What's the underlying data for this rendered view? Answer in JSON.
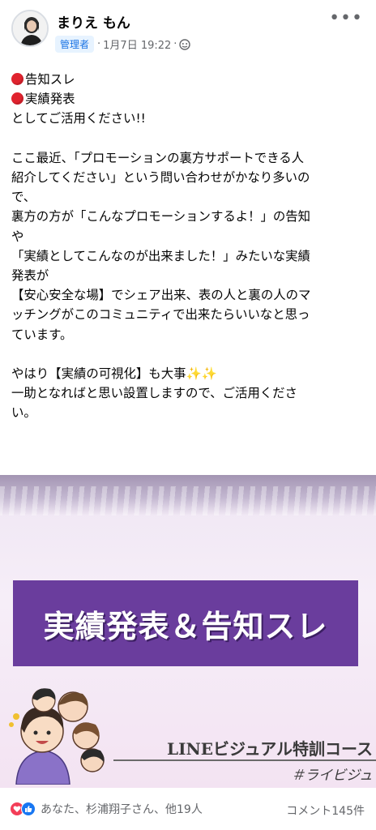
{
  "post": {
    "author": "まりえ もん",
    "badge": "管理者",
    "date": "1月7日 19:22",
    "dot": "·",
    "more": "•••",
    "lines": {
      "l1": "告知スレ",
      "l2": "実績発表",
      "l3": "としてご活用ください!!",
      "body": "ここ最近、「プロモーションの裏方サポートできる人\n紹介してください」という問い合わせがかなり多いの\nで、\n裏方の方が「こんなプロモーションするよ！」の告知\nや\n「実績としてこんなのが出来ました！」みたいな実績\n発表が\n【安心安全な場】でシェア出来、表の人と裏の人のマ\nッチングがこのコミュニティで出来たらいいなと思っ\nています。",
      "tail1": "やはり【実績の可視化】も大事✨✨",
      "tail2": "一助となればと思い設置しますので、ご活用くださ\nい。"
    }
  },
  "banner": {
    "title": "実績発表＆告知スレ",
    "course": "LINEビジュアル特訓コース",
    "tag": "＃ライビジュ"
  },
  "footer": {
    "reactions_text": "あなた、杉浦翔子さん、他19人",
    "comments": "コメント145件"
  },
  "colors": {
    "accent_blue": "#1877f2",
    "banner_purple": "#6a3d9d",
    "love_red": "#f33e58",
    "dot_red": "#e0232e"
  },
  "icons": [
    "avatar",
    "globe-icon",
    "more-icon",
    "red-circle-icon",
    "love-reaction-icon",
    "like-reaction-icon",
    "sparkles-emoji"
  ]
}
